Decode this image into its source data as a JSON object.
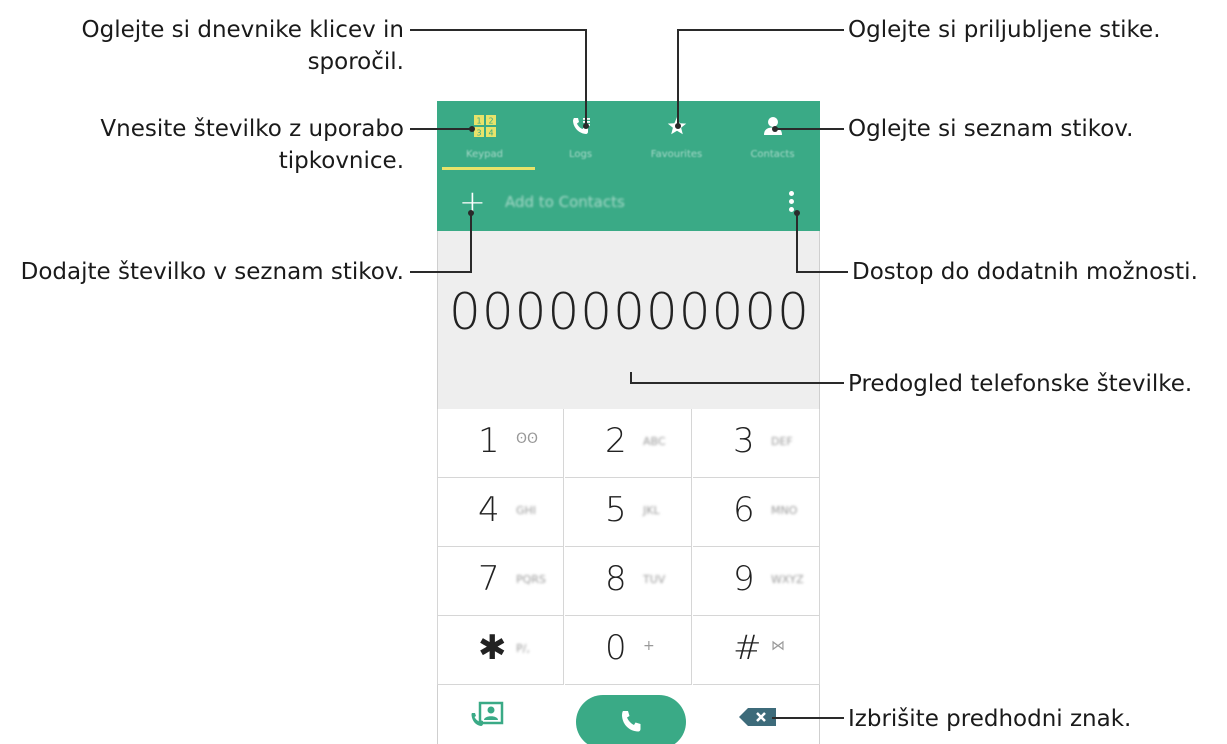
{
  "callouts": {
    "logs": "Oglejte si dnevnike klicev in sporočil.",
    "logs_l1": "Oglejte si dnevnike klicev in",
    "logs_l2": "sporočil.",
    "keypad_l1": "Vnesite številko z uporabo",
    "keypad_l2": "tipkovnice.",
    "add": "Dodajte številko v seznam stikov.",
    "favourites": "Oglejte si priljubljene stike.",
    "contacts": "Oglejte si seznam stikov.",
    "more": "Dostop do dodatnih možnosti.",
    "preview": "Predogled telefonske številke.",
    "delete": "Izbrišite predhodni znak."
  },
  "tabs": [
    {
      "label": "Keypad",
      "icon": "keypad-icon"
    },
    {
      "label": "Logs",
      "icon": "call-log-icon"
    },
    {
      "label": "Favourites",
      "icon": "star-icon"
    },
    {
      "label": "Contacts",
      "icon": "person-icon"
    }
  ],
  "add_to_contacts": "Add to Contacts",
  "phone_number": "00000000000",
  "keys": [
    {
      "digit": "1",
      "sub": "ʘʘ"
    },
    {
      "digit": "2",
      "sub": "ABC"
    },
    {
      "digit": "3",
      "sub": "DEF"
    },
    {
      "digit": "4",
      "sub": "GHI"
    },
    {
      "digit": "5",
      "sub": "JKL"
    },
    {
      "digit": "6",
      "sub": "MNO"
    },
    {
      "digit": "7",
      "sub": "PQRS"
    },
    {
      "digit": "8",
      "sub": "TUV"
    },
    {
      "digit": "9",
      "sub": "WXYZ"
    },
    {
      "digit": "✱",
      "sub": "P/,"
    },
    {
      "digit": "0",
      "sub": "+"
    },
    {
      "digit": "#",
      "sub": "⋈"
    }
  ],
  "colors": {
    "accent": "#3aaa86",
    "tab_indicator": "#e8e36a",
    "display_bg": "#eeeeee"
  }
}
